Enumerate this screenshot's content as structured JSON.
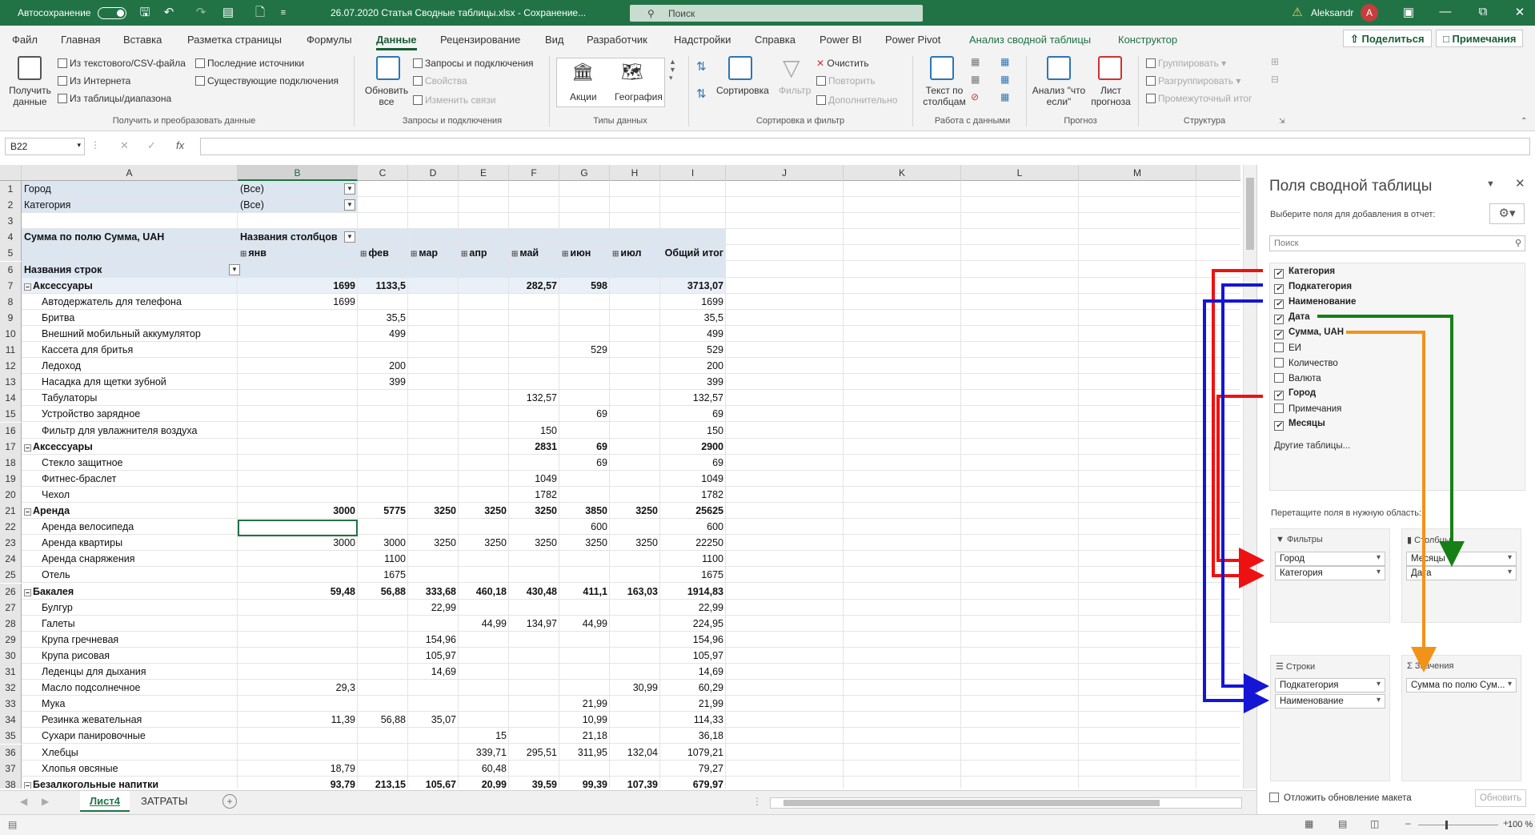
{
  "titlebar": {
    "autosave_label": "Автосохранение",
    "file_title": "26.07.2020 Статья Сводные таблицы.xlsx - Сохранение...",
    "search_placeholder": "Поиск",
    "user_name": "Aleksandr",
    "avatar_initial": "A"
  },
  "menu": {
    "tabs": [
      "Файл",
      "Главная",
      "Вставка",
      "Разметка страницы",
      "Формулы",
      "Данные",
      "Рецензирование",
      "Вид",
      "Разработчик",
      "Надстройки",
      "Справка",
      "Power BI",
      "Power Pivot",
      "Анализ сводной таблицы",
      "Конструктор"
    ],
    "active_tab": "Данные",
    "share": "Поделиться",
    "comments": "Примечания"
  },
  "ribbon": {
    "get_data": {
      "btn": "Получить данные",
      "from_text": "Из текстового/CSV-файла",
      "from_web": "Из Интернета",
      "from_table": "Из таблицы/диапазона",
      "recent": "Последние источники",
      "existing": "Существующие подключения",
      "group": "Получить и преобразовать данные"
    },
    "queries": {
      "refresh": "Обновить все",
      "queries_conn": "Запросы и подключения",
      "properties": "Свойства",
      "edit_links": "Изменить связи",
      "group": "Запросы и подключения"
    },
    "data_types": {
      "stocks": "Акции",
      "geography": "География",
      "group": "Типы данных"
    },
    "sort_filter": {
      "sort": "Сортировка",
      "filter": "Фильтр",
      "clear": "Очистить",
      "reapply": "Повторить",
      "advanced": "Дополнительно",
      "group": "Сортировка и фильтр"
    },
    "data_tools": {
      "text_to_columns": "Текст по столбцам",
      "group": "Работа с данными"
    },
    "forecast": {
      "whatif": "Анализ \"что если\"",
      "sheet": "Лист прогноза",
      "group": "Прогноз"
    },
    "outline": {
      "group_btn": "Группировать",
      "ungroup": "Разгруппировать",
      "subtotal": "Промежуточный итог",
      "group": "Структура"
    }
  },
  "formula_bar": {
    "cell_ref": "B22",
    "formula": ""
  },
  "columns": [
    "A",
    "B",
    "C",
    "D",
    "E",
    "F",
    "G",
    "H",
    "I",
    "J",
    "K",
    "L",
    "M"
  ],
  "selected_column": "B",
  "header_rows": {
    "r1": {
      "label": "Город",
      "value": "(Все)"
    },
    "r2": {
      "label": "Категория",
      "value": "(Все)"
    },
    "r4": {
      "label": "Сумма по полю Сумма, UAH",
      "col_labels": "Названия столбцов"
    },
    "r5_months": [
      "янв",
      "фев",
      "мар",
      "апр",
      "май",
      "июн",
      "июл"
    ],
    "r5_total": "Общий итог",
    "r6": "Названия строк"
  },
  "rows": [
    {
      "n": "7",
      "name": "Аксессуары",
      "group": true,
      "v": [
        "1699",
        "1133,5",
        "",
        "",
        "282,57",
        "598",
        "",
        "3713,07"
      ]
    },
    {
      "n": "8",
      "name": "Автодержатель для телефона",
      "v": [
        "1699",
        "",
        "",
        "",
        "",
        "",
        "",
        "1699"
      ]
    },
    {
      "n": "9",
      "name": "Бритва",
      "v": [
        "",
        "35,5",
        "",
        "",
        "",
        "",
        "",
        "35,5"
      ]
    },
    {
      "n": "10",
      "name": "Внешний мобильный аккумулятор",
      "v": [
        "",
        "499",
        "",
        "",
        "",
        "",
        "",
        "499"
      ]
    },
    {
      "n": "11",
      "name": "Кассета для бритья",
      "v": [
        "",
        "",
        "",
        "",
        "",
        "529",
        "",
        "529"
      ]
    },
    {
      "n": "12",
      "name": "Ледоход",
      "v": [
        "",
        "200",
        "",
        "",
        "",
        "",
        "",
        "200"
      ]
    },
    {
      "n": "13",
      "name": "Насадка для щетки зубной",
      "v": [
        "",
        "399",
        "",
        "",
        "",
        "",
        "",
        "399"
      ]
    },
    {
      "n": "14",
      "name": "Табулаторы",
      "v": [
        "",
        "",
        "",
        "",
        "132,57",
        "",
        "",
        "132,57"
      ]
    },
    {
      "n": "15",
      "name": "Устройство зарядное",
      "v": [
        "",
        "",
        "",
        "",
        "",
        "69",
        "",
        "69"
      ]
    },
    {
      "n": "16",
      "name": "Фильтр для увлажнителя воздуха",
      "v": [
        "",
        "",
        "",
        "",
        "150",
        "",
        "",
        "150"
      ]
    },
    {
      "n": "17",
      "name": "Аксессуары",
      "group": true,
      "v": [
        "",
        "",
        "",
        "",
        "2831",
        "69",
        "",
        "2900"
      ]
    },
    {
      "n": "18",
      "name": "Стекло защитное",
      "v": [
        "",
        "",
        "",
        "",
        "",
        "69",
        "",
        "69"
      ]
    },
    {
      "n": "19",
      "name": "Фитнес-браслет",
      "v": [
        "",
        "",
        "",
        "",
        "1049",
        "",
        "",
        "1049"
      ]
    },
    {
      "n": "20",
      "name": "Чехол",
      "v": [
        "",
        "",
        "",
        "",
        "1782",
        "",
        "",
        "1782"
      ]
    },
    {
      "n": "21",
      "name": "Аренда",
      "group": true,
      "v": [
        "3000",
        "5775",
        "3250",
        "3250",
        "3250",
        "3850",
        "3250",
        "25625"
      ]
    },
    {
      "n": "22",
      "name": "Аренда велосипеда",
      "v": [
        "",
        "",
        "",
        "",
        "",
        "600",
        "",
        "600"
      ]
    },
    {
      "n": "23",
      "name": "Аренда квартиры",
      "v": [
        "3000",
        "3000",
        "3250",
        "3250",
        "3250",
        "3250",
        "3250",
        "22250"
      ]
    },
    {
      "n": "24",
      "name": "Аренда снаряжения",
      "v": [
        "",
        "1100",
        "",
        "",
        "",
        "",
        "",
        "1100"
      ]
    },
    {
      "n": "25",
      "name": "Отель",
      "v": [
        "",
        "1675",
        "",
        "",
        "",
        "",
        "",
        "1675"
      ]
    },
    {
      "n": "26",
      "name": "Бакалея",
      "group": true,
      "v": [
        "59,48",
        "56,88",
        "333,68",
        "460,18",
        "430,48",
        "411,1",
        "163,03",
        "1914,83"
      ]
    },
    {
      "n": "27",
      "name": "Булгур",
      "v": [
        "",
        "",
        "22,99",
        "",
        "",
        "",
        "",
        "22,99"
      ]
    },
    {
      "n": "28",
      "name": "Галеты",
      "v": [
        "",
        "",
        "",
        "44,99",
        "134,97",
        "44,99",
        "",
        "224,95"
      ]
    },
    {
      "n": "29",
      "name": "Крупа гречневая",
      "v": [
        "",
        "",
        "154,96",
        "",
        "",
        "",
        "",
        "154,96"
      ]
    },
    {
      "n": "30",
      "name": "Крупа рисовая",
      "v": [
        "",
        "",
        "105,97",
        "",
        "",
        "",
        "",
        "105,97"
      ]
    },
    {
      "n": "31",
      "name": "Леденцы для дыхания",
      "v": [
        "",
        "",
        "14,69",
        "",
        "",
        "",
        "",
        "14,69"
      ]
    },
    {
      "n": "32",
      "name": "Масло подсолнечное",
      "v": [
        "29,3",
        "",
        "",
        "",
        "",
        "",
        "30,99",
        "60,29"
      ]
    },
    {
      "n": "33",
      "name": "Мука",
      "v": [
        "",
        "",
        "",
        "",
        "",
        "21,99",
        "",
        "21,99"
      ]
    },
    {
      "n": "34",
      "name": "Резинка жевательная",
      "v": [
        "11,39",
        "56,88",
        "35,07",
        "",
        "",
        "10,99",
        "",
        "114,33"
      ]
    },
    {
      "n": "35",
      "name": "Сухари панировочные",
      "v": [
        "",
        "",
        "",
        "15",
        "",
        "21,18",
        "",
        "36,18"
      ]
    },
    {
      "n": "36",
      "name": "Хлебцы",
      "v": [
        "",
        "",
        "",
        "339,71",
        "295,51",
        "311,95",
        "132,04",
        "1079,21"
      ]
    },
    {
      "n": "37",
      "name": "Хлопья овсяные",
      "v": [
        "18,79",
        "",
        "",
        "60,48",
        "",
        "",
        "",
        "79,27"
      ]
    },
    {
      "n": "38",
      "name": "Безалкогольные напитки",
      "group": true,
      "v": [
        "93,79",
        "213,15",
        "105,67",
        "20,99",
        "39,59",
        "99,39",
        "107,39",
        "679,97"
      ]
    }
  ],
  "sheet_tabs": [
    "Лист4",
    "ЗАТРАТЫ"
  ],
  "active_sheet": "Лист4",
  "status": {
    "zoom": "100 %"
  },
  "pivot_pane": {
    "title": "Поля сводной таблицы",
    "subtitle": "Выберите поля для добавления в отчет:",
    "search": "Поиск",
    "fields": [
      {
        "name": "Категория",
        "checked": true
      },
      {
        "name": "Подкатегория",
        "checked": true
      },
      {
        "name": "Наименование",
        "checked": true
      },
      {
        "name": "Дата",
        "checked": true
      },
      {
        "name": "Сумма, UAH",
        "checked": true
      },
      {
        "name": "ЕИ",
        "checked": false
      },
      {
        "name": "Количество",
        "checked": false
      },
      {
        "name": "Валюта",
        "checked": false
      },
      {
        "name": "Город",
        "checked": true
      },
      {
        "name": "Примечания",
        "checked": false
      },
      {
        "name": "Месяцы",
        "checked": true
      }
    ],
    "other_tables": "Другие таблицы...",
    "drag_hint": "Перетащите поля в нужную область:",
    "areas": {
      "filters": {
        "label": "Фильтры",
        "items": [
          "Город",
          "Категория"
        ]
      },
      "columns": {
        "label": "Столбцы",
        "items": [
          "Месяцы",
          "Дата"
        ]
      },
      "rows": {
        "label": "Строки",
        "items": [
          "Подкатегория",
          "Наименование"
        ]
      },
      "values": {
        "label": "Значения",
        "items": [
          "Сумма по полю Сум..."
        ]
      }
    },
    "defer": "Отложить обновление макета",
    "update": "Обновить"
  },
  "colors": {
    "accent": "#217346",
    "red": "#ee1111",
    "blue": "#1515d6",
    "green": "#168016",
    "orange": "#f39219"
  }
}
